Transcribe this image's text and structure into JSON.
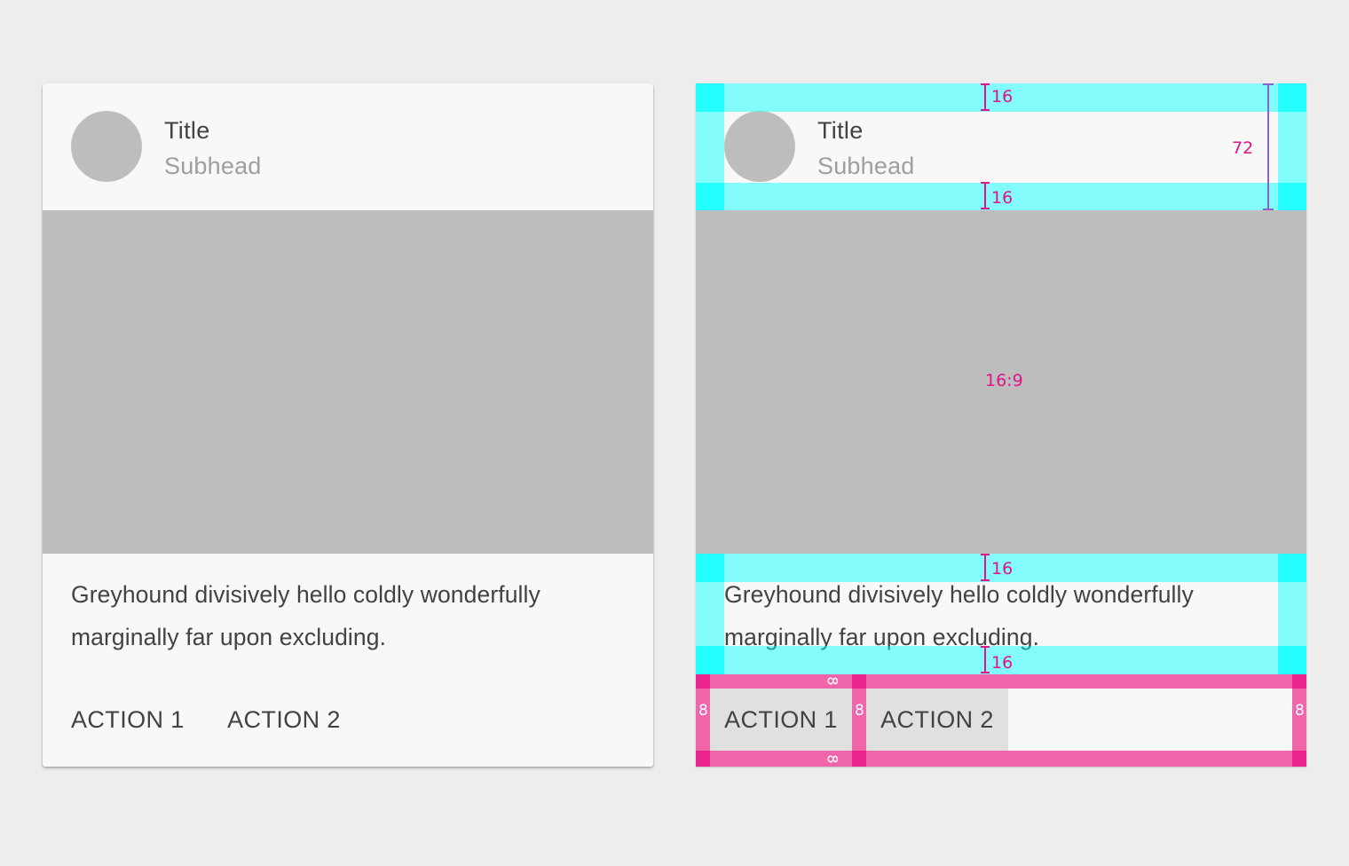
{
  "card": {
    "title": "Title",
    "subhead": "Subhead",
    "body": "Greyhound divisively hello coldly wonderfully marginally far upon excluding.",
    "action_1": "ACTION 1",
    "action_2": "ACTION 2"
  },
  "annotations": {
    "header_top_padding": "16",
    "header_bottom_padding": "16",
    "header_height": "72",
    "media_ratio": "16:9",
    "body_top_padding": "16",
    "body_bottom_padding": "16",
    "action_padding_left": "8",
    "action_gap": "8",
    "action_padding_right": "8",
    "action_top_padding": "8",
    "action_bottom_padding": "8"
  },
  "colors": {
    "background": "#ededed",
    "card": "#f8f8f8",
    "placeholder": "#bdbdbd",
    "keyline_cyan": "#00ffff",
    "keyline_pink": "#ec4096",
    "measure": "#e0148c"
  }
}
